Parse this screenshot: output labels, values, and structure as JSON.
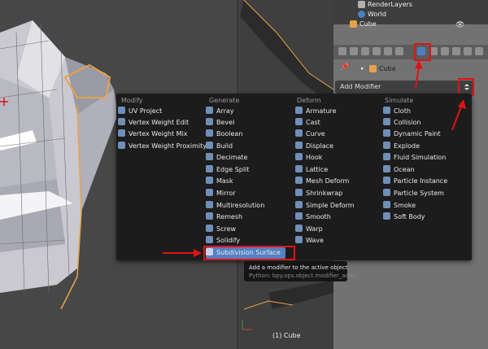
{
  "outliner": {
    "items": [
      {
        "label": "RenderLayers"
      },
      {
        "label": "World"
      },
      {
        "label": "Cube"
      }
    ]
  },
  "breadcrumb": {
    "object": "Cube"
  },
  "add_modifier": {
    "label": "Add Modifier"
  },
  "menu": {
    "columns": [
      {
        "title": "Modify",
        "items": [
          "UV Project",
          "Vertex Weight Edit",
          "Vertex Weight Mix",
          "Vertex Weight Proximity"
        ]
      },
      {
        "title": "Generate",
        "items": [
          "Array",
          "Bevel",
          "Boolean",
          "Build",
          "Decimate",
          "Edge Split",
          "Mask",
          "Mirror",
          "Multiresolution",
          "Remesh",
          "Screw",
          "Solidify",
          "Subdivision Surface"
        ]
      },
      {
        "title": "Deform",
        "items": [
          "Armature",
          "Cast",
          "Curve",
          "Displace",
          "Hook",
          "Lattice",
          "Mesh Deform",
          "Shrinkwrap",
          "Simple Deform",
          "Smooth",
          "Warp",
          "Wave"
        ]
      },
      {
        "title": "Simulate",
        "items": [
          "Cloth",
          "Collision",
          "Dynamic Paint",
          "Explode",
          "Fluid Simulation",
          "Ocean",
          "Particle Instance",
          "Particle System",
          "Smoke",
          "Soft Body"
        ]
      }
    ],
    "selected_item": "Subdivision Surface"
  },
  "tooltip": {
    "description": "Add a modifier to the active object",
    "python": "Python: bpy.ops.object.modifier_add()"
  },
  "viewport": {
    "status_label": "(1) Cube"
  },
  "colors": {
    "highlight": "#e01313",
    "selected": "#5680c2",
    "menu_bg": "#1c1c1c"
  }
}
